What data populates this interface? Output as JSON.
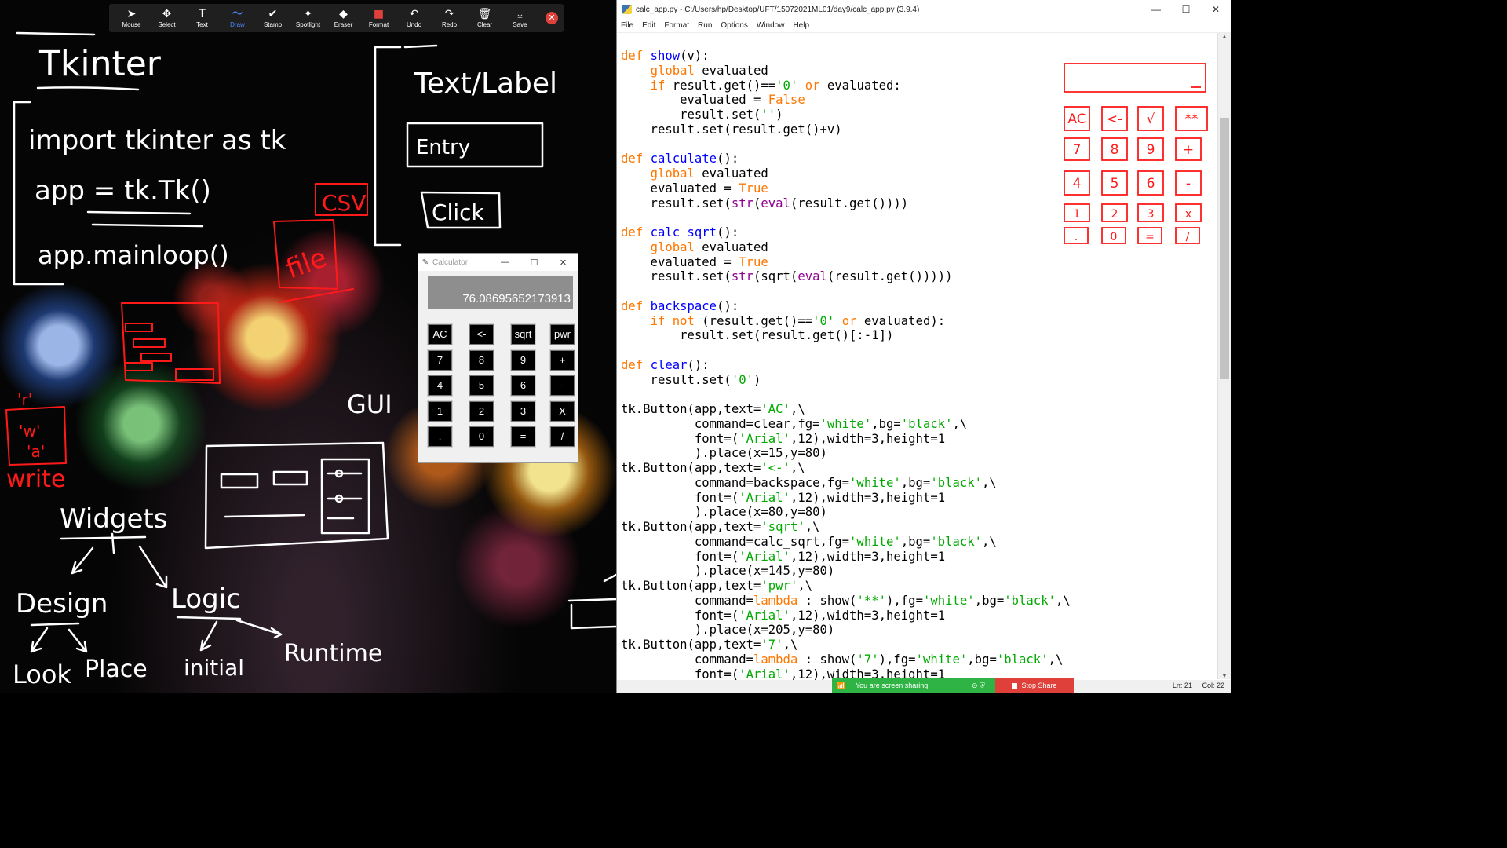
{
  "toolbar": {
    "items": [
      {
        "label": "Mouse",
        "icon": "pointer-icon",
        "glyph": "➤"
      },
      {
        "label": "Select",
        "icon": "move-icon",
        "glyph": "✥"
      },
      {
        "label": "Text",
        "icon": "text-icon",
        "glyph": "T"
      },
      {
        "label": "Draw",
        "icon": "draw-icon",
        "glyph": "〜"
      },
      {
        "label": "Stamp",
        "icon": "stamp-check-icon",
        "glyph": "✔"
      },
      {
        "label": "Spotlight",
        "icon": "spotlight-icon",
        "glyph": "✦"
      },
      {
        "label": "Eraser",
        "icon": "eraser-icon",
        "glyph": "◆"
      },
      {
        "label": "Format",
        "icon": "format-icon",
        "glyph": "■"
      },
      {
        "label": "Undo",
        "icon": "undo-icon",
        "glyph": "↶"
      },
      {
        "label": "Redo",
        "icon": "redo-icon",
        "glyph": "↷"
      },
      {
        "label": "Clear",
        "icon": "trash-icon",
        "glyph": "🗑"
      },
      {
        "label": "Save",
        "icon": "save-icon",
        "glyph": "⤓"
      }
    ],
    "active": "Draw",
    "close_glyph": "✕"
  },
  "whiteboard": {
    "title": "Tkinter",
    "code_lines": [
      "import tkinter as tk",
      "app = tk.Tk()",
      "app.mainloop()"
    ],
    "widgets_box": {
      "text": "Text/Label",
      "entry": "Entry",
      "click": "Click"
    },
    "csv": "CSV",
    "file": "file",
    "write_modes": [
      "'r'",
      "'w'",
      "'a'"
    ],
    "write": "write",
    "gui": "GUI",
    "tree": {
      "root": "Widgets",
      "left": "Design",
      "right": "Logic",
      "ll": "Look",
      "lr": "Place",
      "rl": "initial",
      "rr": "Runtime"
    }
  },
  "calculator": {
    "title": "Calculator",
    "display": "76.08695652173913",
    "buttons": [
      [
        "AC",
        "<-",
        "sqrt",
        "pwr"
      ],
      [
        "7",
        "8",
        "9",
        "+"
      ],
      [
        "4",
        "5",
        "6",
        "-"
      ],
      [
        "1",
        "2",
        "3",
        "X"
      ],
      [
        ".",
        "0",
        "=",
        "/"
      ]
    ]
  },
  "idle": {
    "title": "calc_app.py - C:/Users/hp/Desktop/UFT/15072021ML01/day9/calc_app.py (3.9.4)",
    "menu": [
      "File",
      "Edit",
      "Format",
      "Run",
      "Options",
      "Window",
      "Help"
    ],
    "status": {
      "ln": "Ln: 21",
      "col": "Col: 22"
    }
  },
  "code": [
    [
      [
        "kw",
        "def "
      ],
      [
        "def",
        "show"
      ],
      [
        "",
        "(v):"
      ]
    ],
    [
      [
        "",
        "    "
      ],
      [
        "kw",
        "global"
      ],
      [
        "",
        " evaluated"
      ]
    ],
    [
      [
        "",
        "    "
      ],
      [
        "kw",
        "if"
      ],
      [
        "",
        " result.get()=="
      ],
      [
        "st",
        "'0'"
      ],
      [
        "",
        " "
      ],
      [
        "kw",
        "or"
      ],
      [
        "",
        " evaluated:"
      ]
    ],
    [
      [
        "",
        "        evaluated = "
      ],
      [
        "kw",
        "False"
      ]
    ],
    [
      [
        "",
        "        result.set("
      ],
      [
        "st",
        "''"
      ],
      [
        "",
        ")"
      ]
    ],
    [
      [
        "",
        "    result.set(result.get()+v)"
      ]
    ],
    [
      [
        "",
        ""
      ]
    ],
    [
      [
        "kw",
        "def "
      ],
      [
        "def",
        "calculate"
      ],
      [
        "",
        "():"
      ]
    ],
    [
      [
        "",
        "    "
      ],
      [
        "kw",
        "global"
      ],
      [
        "",
        " evaluated"
      ]
    ],
    [
      [
        "",
        "    evaluated = "
      ],
      [
        "kw",
        "True"
      ]
    ],
    [
      [
        "",
        "    result.set("
      ],
      [
        "bi",
        "str"
      ],
      [
        "",
        "("
      ],
      [
        "bi",
        "eval"
      ],
      [
        "",
        "(result.get())))"
      ]
    ],
    [
      [
        "",
        ""
      ]
    ],
    [
      [
        "kw",
        "def "
      ],
      [
        "def",
        "calc_sqrt"
      ],
      [
        "",
        "():"
      ]
    ],
    [
      [
        "",
        "    "
      ],
      [
        "kw",
        "global"
      ],
      [
        "",
        " evaluated"
      ]
    ],
    [
      [
        "",
        "    evaluated = "
      ],
      [
        "kw",
        "True"
      ]
    ],
    [
      [
        "",
        "    result.set("
      ],
      [
        "bi",
        "str"
      ],
      [
        "",
        "(sqrt("
      ],
      [
        "bi",
        "eval"
      ],
      [
        "",
        "(result.get()))))"
      ]
    ],
    [
      [
        "",
        ""
      ]
    ],
    [
      [
        "kw",
        "def "
      ],
      [
        "def",
        "backspace"
      ],
      [
        "",
        "():"
      ]
    ],
    [
      [
        "",
        "    "
      ],
      [
        "kw",
        "if not"
      ],
      [
        "",
        " (result.get()=="
      ],
      [
        "st",
        "'0'"
      ],
      [
        "",
        " "
      ],
      [
        "kw",
        "or"
      ],
      [
        "",
        " evaluated):"
      ]
    ],
    [
      [
        "",
        "        result.set(result.get()[:-1])"
      ]
    ],
    [
      [
        "",
        ""
      ]
    ],
    [
      [
        "kw",
        "def "
      ],
      [
        "def",
        "clear"
      ],
      [
        "",
        "():"
      ]
    ],
    [
      [
        "",
        "    result.set("
      ],
      [
        "st",
        "'0'"
      ],
      [
        "",
        ")"
      ]
    ],
    [
      [
        "",
        ""
      ]
    ],
    [
      [
        "",
        "tk.Button(app,text="
      ],
      [
        "st",
        "'AC'"
      ],
      [
        "",
        ",\\"
      ]
    ],
    [
      [
        "",
        "          command=clear,fg="
      ],
      [
        "st",
        "'white'"
      ],
      [
        "",
        ",bg="
      ],
      [
        "st",
        "'black'"
      ],
      [
        "",
        ",\\"
      ]
    ],
    [
      [
        "",
        "          font=("
      ],
      [
        "st",
        "'Arial'"
      ],
      [
        "",
        ",12),width=3,height=1"
      ]
    ],
    [
      [
        "",
        "          ).place(x=15,y=80)"
      ]
    ],
    [
      [
        "",
        "tk.Button(app,text="
      ],
      [
        "st",
        "'<-'"
      ],
      [
        "",
        ",\\"
      ]
    ],
    [
      [
        "",
        "          command=backspace,fg="
      ],
      [
        "st",
        "'white'"
      ],
      [
        "",
        ",bg="
      ],
      [
        "st",
        "'black'"
      ],
      [
        "",
        ",\\"
      ]
    ],
    [
      [
        "",
        "          font=("
      ],
      [
        "st",
        "'Arial'"
      ],
      [
        "",
        ",12),width=3,height=1"
      ]
    ],
    [
      [
        "",
        "          ).place(x=80,y=80)"
      ]
    ],
    [
      [
        "",
        "tk.Button(app,text="
      ],
      [
        "st",
        "'sqrt'"
      ],
      [
        "",
        ",\\"
      ]
    ],
    [
      [
        "",
        "          command=calc_sqrt,fg="
      ],
      [
        "st",
        "'white'"
      ],
      [
        "",
        ",bg="
      ],
      [
        "st",
        "'black'"
      ],
      [
        "",
        ",\\"
      ]
    ],
    [
      [
        "",
        "          font=("
      ],
      [
        "st",
        "'Arial'"
      ],
      [
        "",
        ",12),width=3,height=1"
      ]
    ],
    [
      [
        "",
        "          ).place(x=145,y=80)"
      ]
    ],
    [
      [
        "",
        "tk.Button(app,text="
      ],
      [
        "st",
        "'pwr'"
      ],
      [
        "",
        ",\\"
      ]
    ],
    [
      [
        "",
        "          command="
      ],
      [
        "kw",
        "lambda"
      ],
      [
        "",
        " : show("
      ],
      [
        "st",
        "'**'"
      ],
      [
        "",
        "),fg="
      ],
      [
        "st",
        "'white'"
      ],
      [
        "",
        ",bg="
      ],
      [
        "st",
        "'black'"
      ],
      [
        "",
        ",\\"
      ]
    ],
    [
      [
        "",
        "          font=("
      ],
      [
        "st",
        "'Arial'"
      ],
      [
        "",
        ",12),width=3,height=1"
      ]
    ],
    [
      [
        "",
        "          ).place(x=205,y=80)"
      ]
    ],
    [
      [
        "",
        "tk.Button(app,text="
      ],
      [
        "st",
        "'7'"
      ],
      [
        "",
        ",\\"
      ]
    ],
    [
      [
        "",
        "          command="
      ],
      [
        "kw",
        "lambda"
      ],
      [
        "",
        " : show("
      ],
      [
        "st",
        "'7'"
      ],
      [
        "",
        "),fg="
      ],
      [
        "st",
        "'white'"
      ],
      [
        "",
        ",bg="
      ],
      [
        "st",
        "'black'"
      ],
      [
        "",
        ",\\"
      ]
    ],
    [
      [
        "",
        "          font=("
      ],
      [
        "st",
        "'Arial'"
      ],
      [
        "",
        ",12),width=3,height=1"
      ]
    ]
  ],
  "sketch": {
    "keys": [
      [
        "AC",
        "<-",
        "√",
        "**"
      ],
      [
        "7",
        "8",
        "9",
        "+"
      ],
      [
        "4",
        "5",
        "6",
        "-"
      ],
      [
        "1",
        "2",
        "3",
        "x"
      ],
      [
        ".",
        "0",
        "=",
        "/"
      ]
    ]
  },
  "share": {
    "status": "You are screen sharing",
    "stop": "Stop Share"
  },
  "colors": {
    "ink_white": "#ffffff",
    "ink_red": "#ff1a1a",
    "zoom_green": "#2fb344",
    "zoom_red": "#e0403a"
  }
}
